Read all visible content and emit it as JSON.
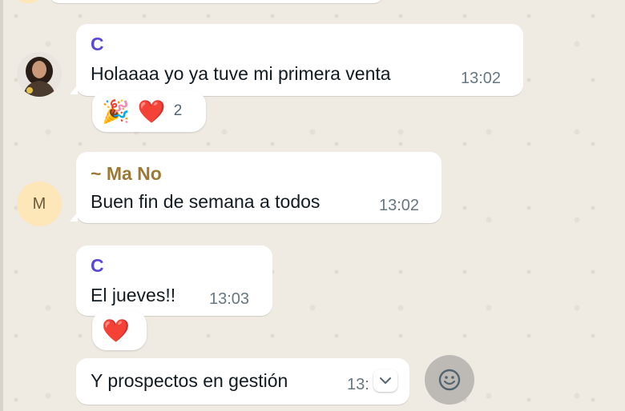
{
  "messages": [
    {
      "sender": "C",
      "sender_color": "#5b47d6",
      "text": "Holaaaa yo ya tuve mi primera venta",
      "time": "13:02",
      "avatar": "photo",
      "reactions": {
        "emojis": [
          "🎉",
          "❤️"
        ],
        "count": "2"
      }
    },
    {
      "sender": "~ Ma No",
      "sender_color": "#9c7a35",
      "text": "Buen fin de semana a todos",
      "time": "13:02",
      "avatar": "M"
    },
    {
      "sender": "C",
      "sender_color": "#5b47d6",
      "text": "El jueves!!",
      "time": "13:03",
      "reactions": {
        "emojis": [
          "❤️"
        ]
      }
    },
    {
      "text": "Y prospectos en gestión",
      "time": "13:"
    }
  ],
  "icons": {
    "scroll_down": "chevron-down-icon",
    "emoji": "emoji-smile-icon"
  }
}
